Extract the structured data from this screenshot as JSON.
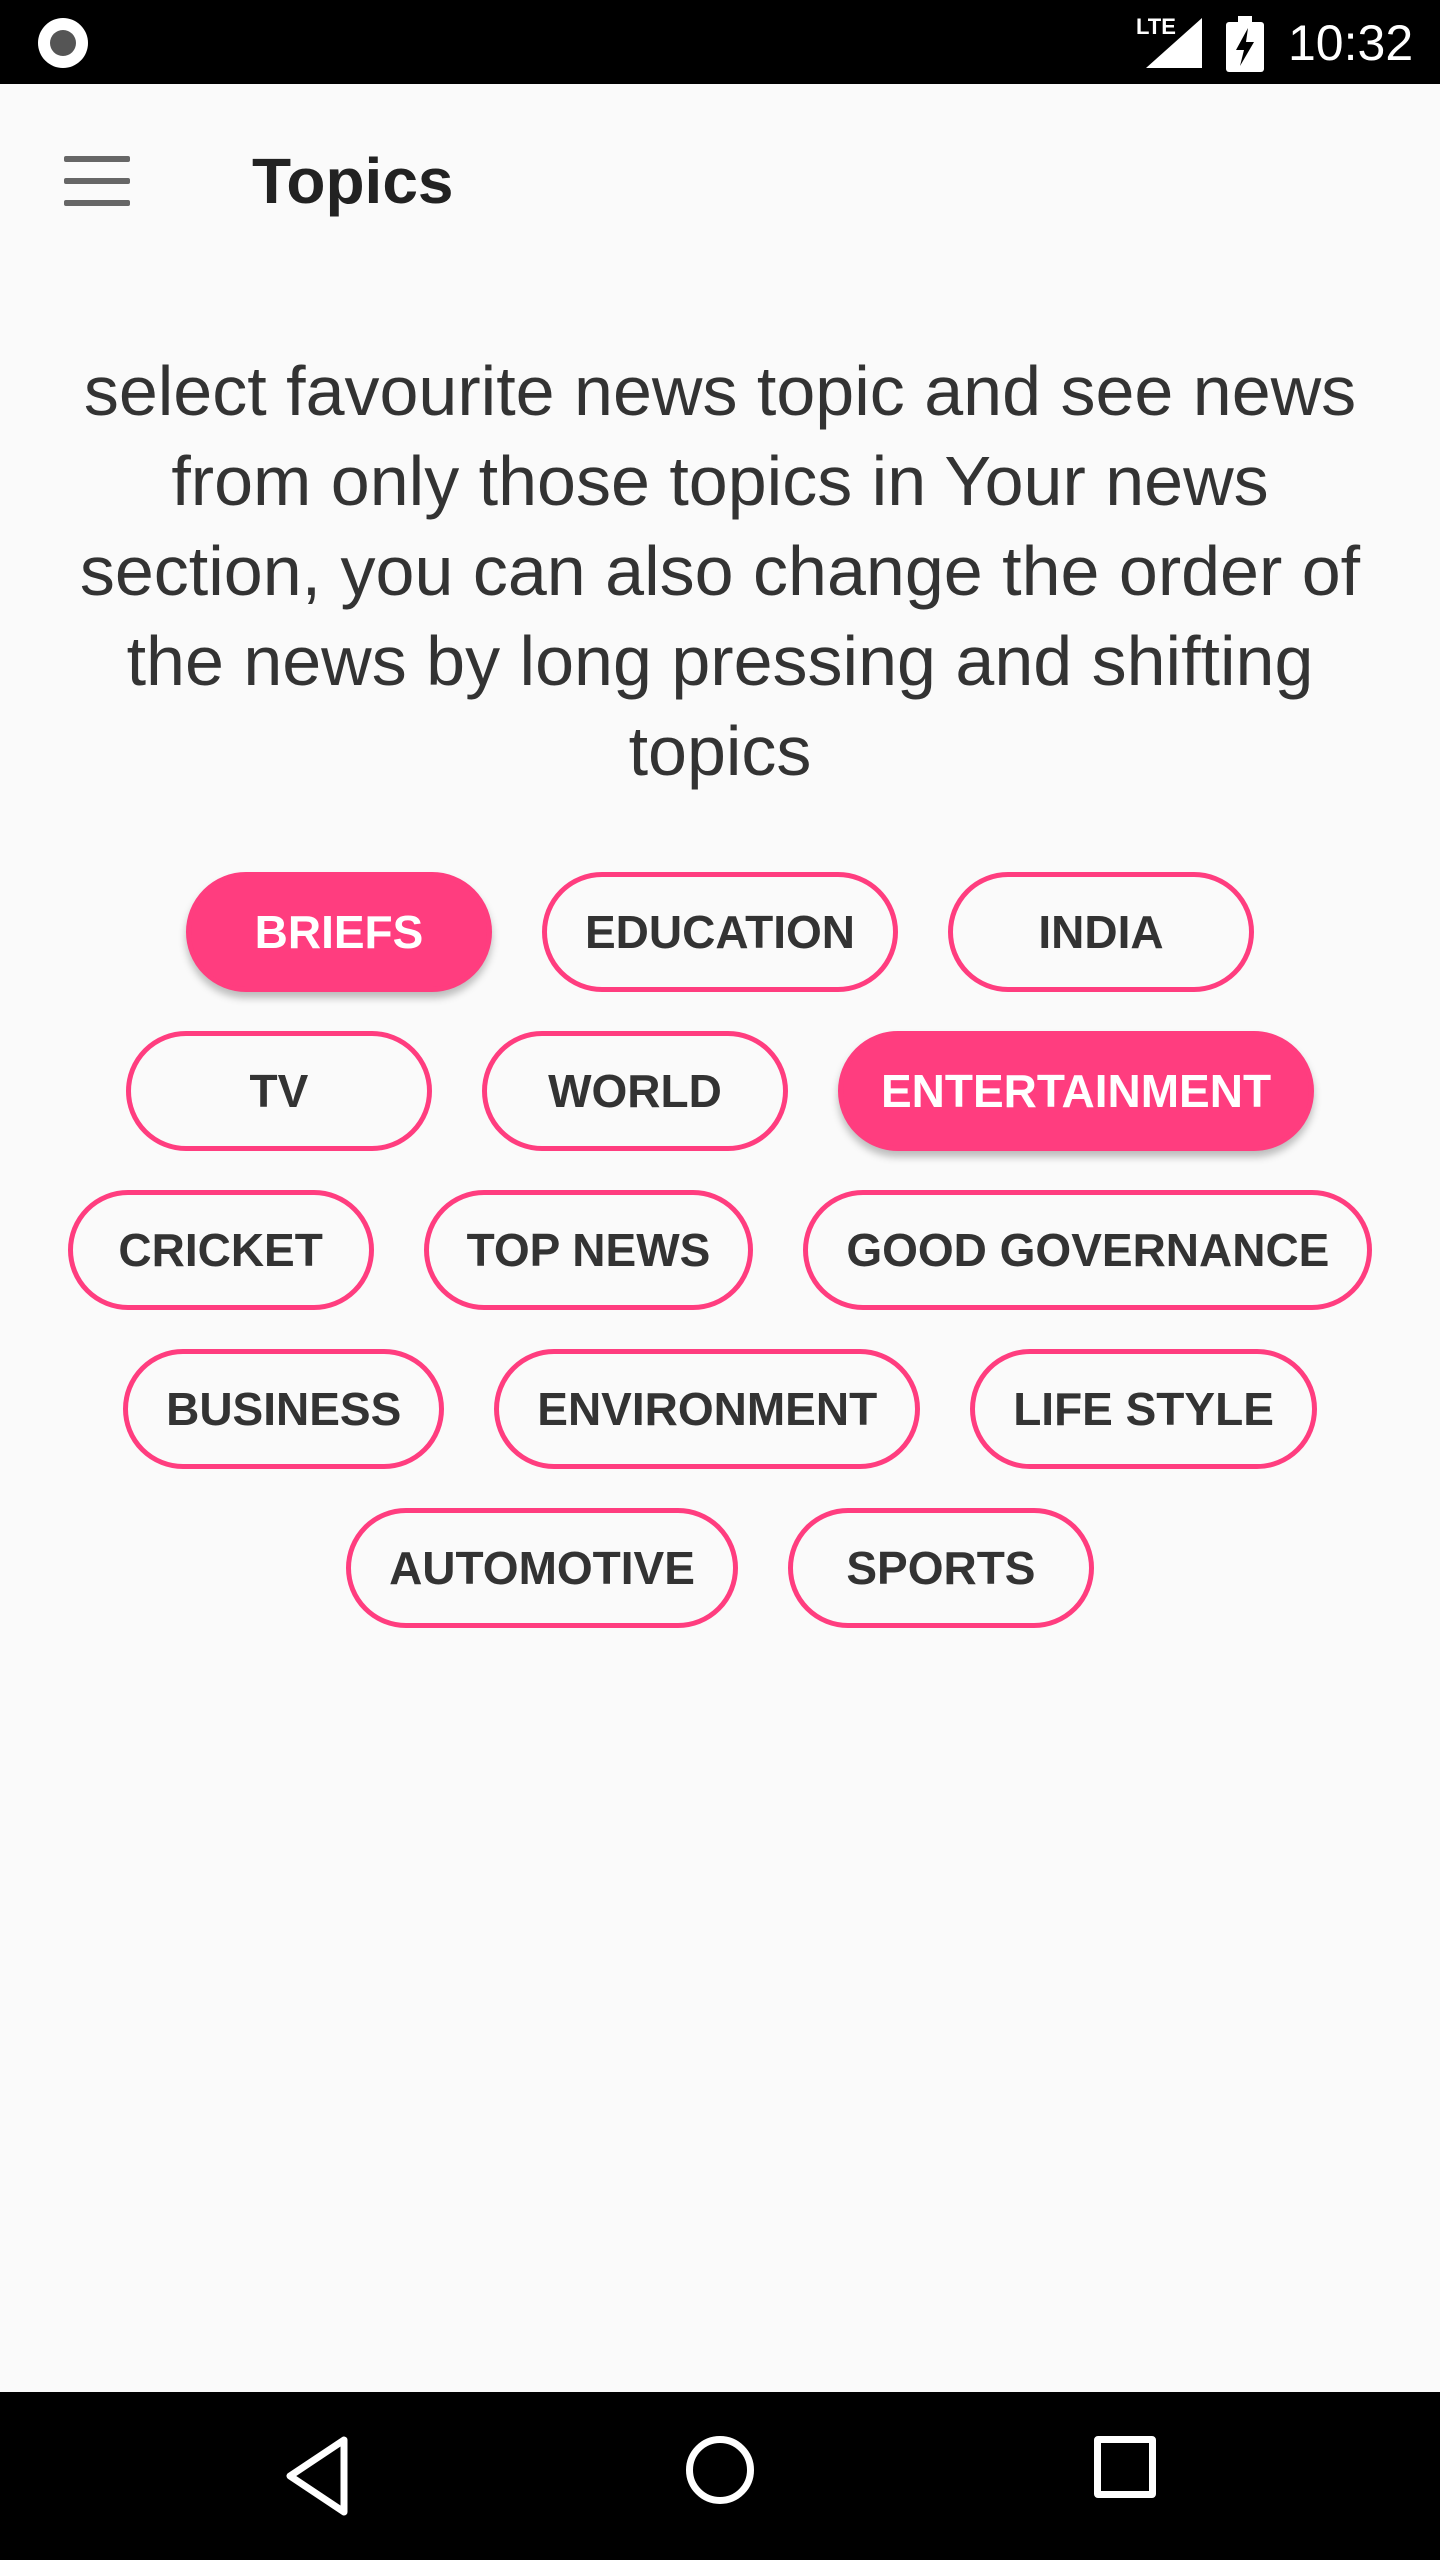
{
  "status_bar": {
    "network_label": "LTE",
    "time": "10:32",
    "icons": [
      "record-icon",
      "signal-icon",
      "battery-charging-icon"
    ]
  },
  "app_bar": {
    "title": "Topics",
    "menu_icon": "menu-icon"
  },
  "intro_text": "select favourite news topic and see news from only those topics in Your news section, you can also change the order of the news by long pressing and shifting topics",
  "accent_color": "#ff3d7f",
  "topics": {
    "rows": [
      [
        {
          "label": "BRIEFS",
          "selected": true
        },
        {
          "label": "EDUCATION",
          "selected": false
        },
        {
          "label": "INDIA",
          "selected": false
        }
      ],
      [
        {
          "label": "TV",
          "selected": false
        },
        {
          "label": "WORLD",
          "selected": false
        },
        {
          "label": "ENTERTAINMENT",
          "selected": true
        }
      ],
      [
        {
          "label": "CRICKET",
          "selected": false
        },
        {
          "label": "TOP NEWS",
          "selected": false
        },
        {
          "label": "GOOD GOVERNANCE",
          "selected": false
        }
      ],
      [
        {
          "label": "BUSINESS",
          "selected": false
        },
        {
          "label": "ENVIRONMENT",
          "selected": false
        },
        {
          "label": "LIFE STYLE",
          "selected": false
        }
      ],
      [
        {
          "label": "AUTOMOTIVE",
          "selected": false
        },
        {
          "label": "SPORTS",
          "selected": false
        }
      ]
    ]
  },
  "nav_bar": {
    "icons": [
      "back-icon",
      "home-icon",
      "recent-apps-icon"
    ]
  }
}
